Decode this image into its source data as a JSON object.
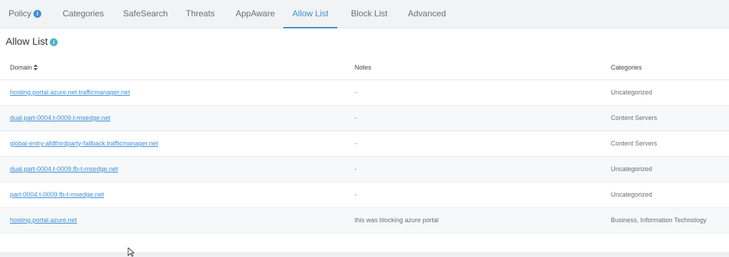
{
  "tabs": [
    {
      "label": "Policy",
      "has_info": true,
      "active": false
    },
    {
      "label": "Categories",
      "active": false
    },
    {
      "label": "SafeSearch",
      "active": false
    },
    {
      "label": "Threats",
      "active": false
    },
    {
      "label": "AppAware",
      "active": false
    },
    {
      "label": "Allow List",
      "active": true
    },
    {
      "label": "Block List",
      "active": false
    },
    {
      "label": "Advanced",
      "active": false
    }
  ],
  "page": {
    "title": "Allow List",
    "title_icon": "info-icon"
  },
  "table": {
    "headers": {
      "domain": "Domain",
      "notes": "Notes",
      "categories": "Categories"
    },
    "rows": [
      {
        "domain": "hosting.portal.azure.net.trafficmanager.net",
        "notes": "-",
        "categories": "Uncategorized"
      },
      {
        "domain": "dual.part-0004.t-0009.t-msedge.net",
        "notes": "-",
        "categories": "Content Servers"
      },
      {
        "domain": "global-entry-afdthirdparty-fallback.trafficmanager.net",
        "notes": "-",
        "categories": "Content Servers"
      },
      {
        "domain": "dual.part-0004.t-0009.fb-t-msedge.net",
        "notes": "-",
        "categories": "Uncategorized"
      },
      {
        "domain": "part-0004.t-0009.fb-t-msedge.net",
        "notes": "-",
        "categories": "Uncategorized"
      },
      {
        "domain": "hosting.portal.azure.net",
        "notes": "this was blocking azure portal",
        "categories": "Business, Information Technology"
      }
    ]
  },
  "colors": {
    "accent": "#3d8fd6",
    "tab_bar": "#f1f3f4",
    "info_teal": "#4fb3c4"
  }
}
